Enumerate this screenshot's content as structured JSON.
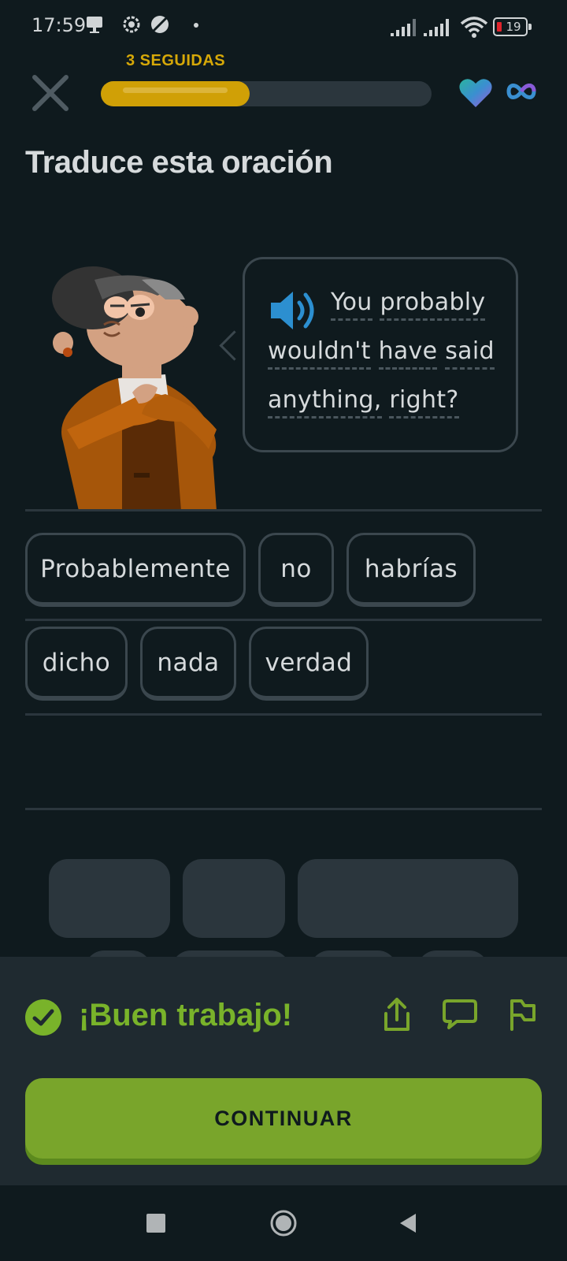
{
  "status_bar": {
    "time": "17:59",
    "battery": "19"
  },
  "header": {
    "streak_label": "3 SEGUIDAS",
    "progress": 0.45
  },
  "exercise": {
    "title": "Traduce esta oración",
    "prompt_lines": [
      [
        "You",
        "probably"
      ],
      [
        "wouldn't",
        "have",
        "said"
      ],
      [
        "anything,",
        "right?"
      ]
    ]
  },
  "answer_words": [
    "Probablemente",
    "no",
    "habrías",
    "dicho",
    "nada",
    "verdad"
  ],
  "feedback": {
    "message": "¡Buen trabajo!",
    "continue_label": "CONTINUAR"
  },
  "colors": {
    "accent_green": "#79a52b",
    "streak_gold": "#d0a006",
    "background": "#0f1a1e"
  },
  "icons": [
    "close-icon",
    "heart-icon",
    "infinity-icon",
    "speaker-icon",
    "check-icon",
    "share-icon",
    "comment-icon",
    "report-flag-icon"
  ]
}
